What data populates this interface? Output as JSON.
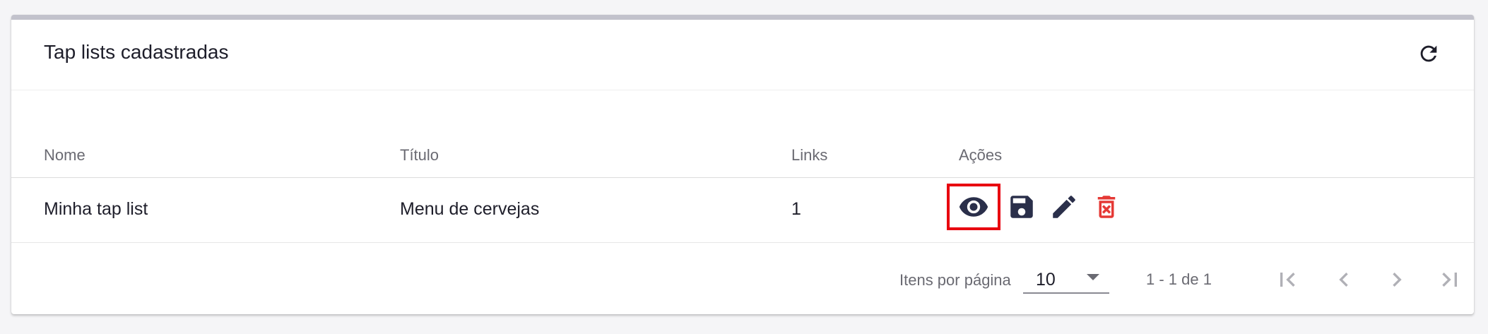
{
  "card": {
    "title": "Tap lists cadastradas"
  },
  "table": {
    "columns": [
      "Nome",
      "Título",
      "Links",
      "Ações"
    ],
    "rows": [
      {
        "nome": "Minha tap list",
        "titulo": "Menu de cervejas",
        "links": "1"
      }
    ]
  },
  "paginator": {
    "items_per_page_label": "Itens por página",
    "items_per_page_value": "10",
    "range_label": "1 - 1 de 1"
  },
  "icons": {
    "refresh": "refresh-icon",
    "view": "eye-icon",
    "save": "save-icon",
    "edit": "pencil-icon",
    "delete": "trash-icon",
    "first": "first-page-icon",
    "prev": "chevron-left-icon",
    "next": "chevron-right-icon",
    "last": "last-page-icon"
  },
  "colors": {
    "icon_dark": "#2a2f4a",
    "delete_red": "#e53935",
    "highlight_red": "#e8000f",
    "nav_disabled": "#b0b0b6"
  }
}
